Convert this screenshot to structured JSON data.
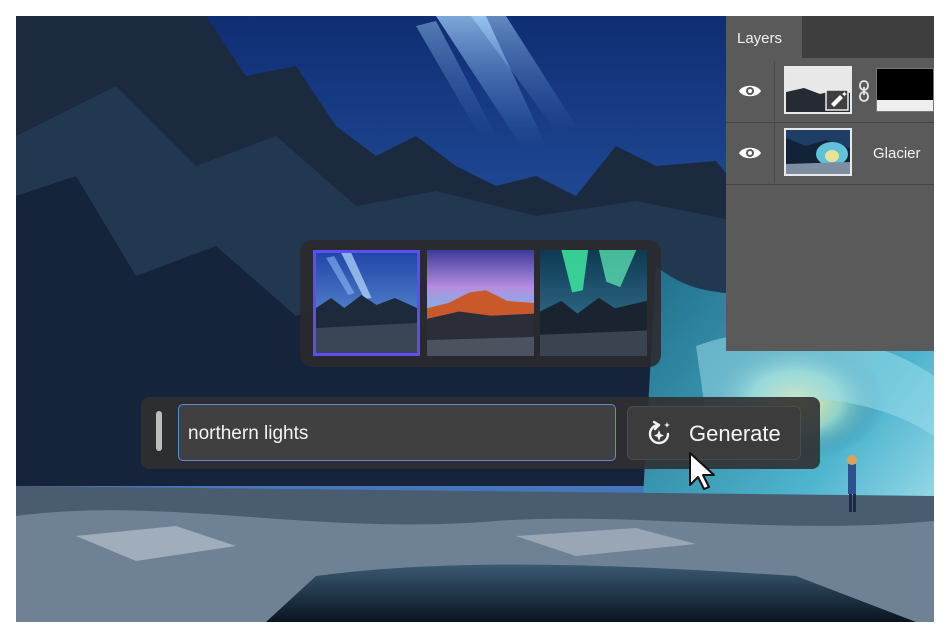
{
  "layers_panel": {
    "tab_label": "Layers",
    "layers": [
      {
        "name": ""
      },
      {
        "name": "Glacier"
      }
    ]
  },
  "generate_bar": {
    "prompt_value": "northern lights",
    "button_label": "Generate"
  },
  "variations": {
    "count": 3,
    "selected_index": 0
  },
  "colors": {
    "accent": "#5d4df2",
    "focus_border": "#5c8ad6",
    "panel_bg": "#5a5a5a"
  }
}
